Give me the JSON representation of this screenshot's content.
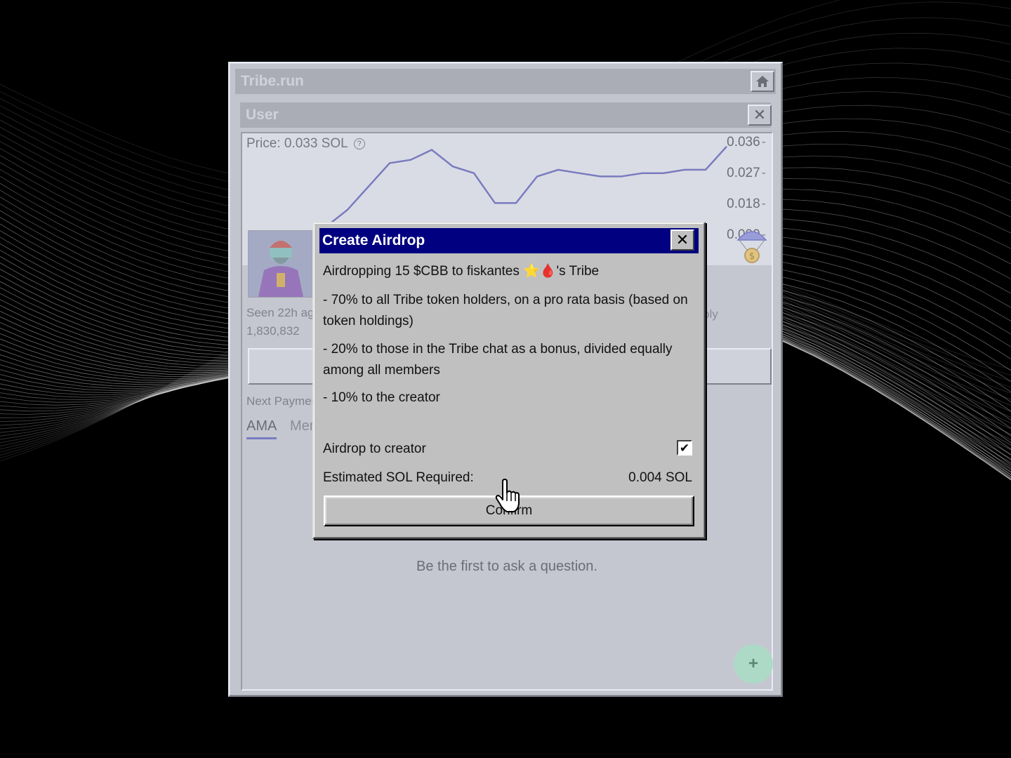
{
  "window": {
    "title": "Tribe.run",
    "subtitle": "User",
    "close_glyph": "✕"
  },
  "icons": {
    "home": "home-icon",
    "close": "close-icon",
    "help": "help-icon",
    "parachute": "parachute-coin-icon",
    "add": "plus-icon",
    "cursor": "hand-pointer-icon"
  },
  "price": {
    "label": "Price: 0.033 SOL",
    "help_glyph": "?"
  },
  "chart_data": {
    "type": "line",
    "ylim": [
      0.009,
      0.036
    ],
    "yticks": [
      "0.036",
      "0.027",
      "0.018",
      "0.009"
    ],
    "x": [
      0,
      5,
      10,
      15,
      20,
      25,
      30,
      35,
      40,
      45,
      50,
      55,
      60,
      65,
      70,
      75,
      80,
      85,
      90,
      95,
      100
    ],
    "series": [
      {
        "values": [
          0.008,
          0.011,
          0.016,
          0.023,
          0.03,
          0.031,
          0.034,
          0.029,
          0.027,
          0.018,
          0.018,
          0.026,
          0.028,
          0.027,
          0.026,
          0.026,
          0.027,
          0.027,
          0.028,
          0.028,
          0.035
        ],
        "color": "#4a4aa8"
      }
    ]
  },
  "profile": {
    "seen": "Seen 22h ag",
    "number": "1,830,832",
    "reply_fragment": "ply",
    "next_payment": "Next Paymen",
    "tabs": [
      "AMA",
      "Mer"
    ],
    "empty_message": "Be the first to ask a question.",
    "add_glyph": "+"
  },
  "modal": {
    "title": "Create Airdrop",
    "close_glyph": "✕",
    "line1": "Airdropping 15 $CBB to fiskantes ⭐🩸's Tribe",
    "p1": "- 70% to all Tribe token holders, on a pro rata basis (based on token holdings)",
    "p2": "- 20% to those in the Tribe chat as a bonus, divided equally among all members",
    "p3": "- 10% to the creator",
    "checkbox_label": "Airdrop to creator",
    "checkbox_checked": true,
    "check_glyph": "✔",
    "estimate_label": "Estimated SOL Required:",
    "estimate_value": "0.004 SOL",
    "confirm_label": "Confirm"
  },
  "colors": {
    "modal_title_bg": "#000080",
    "line": "#4a4aa8",
    "tab_underline": "#4a4ab0",
    "fab": "#9be3b3"
  }
}
